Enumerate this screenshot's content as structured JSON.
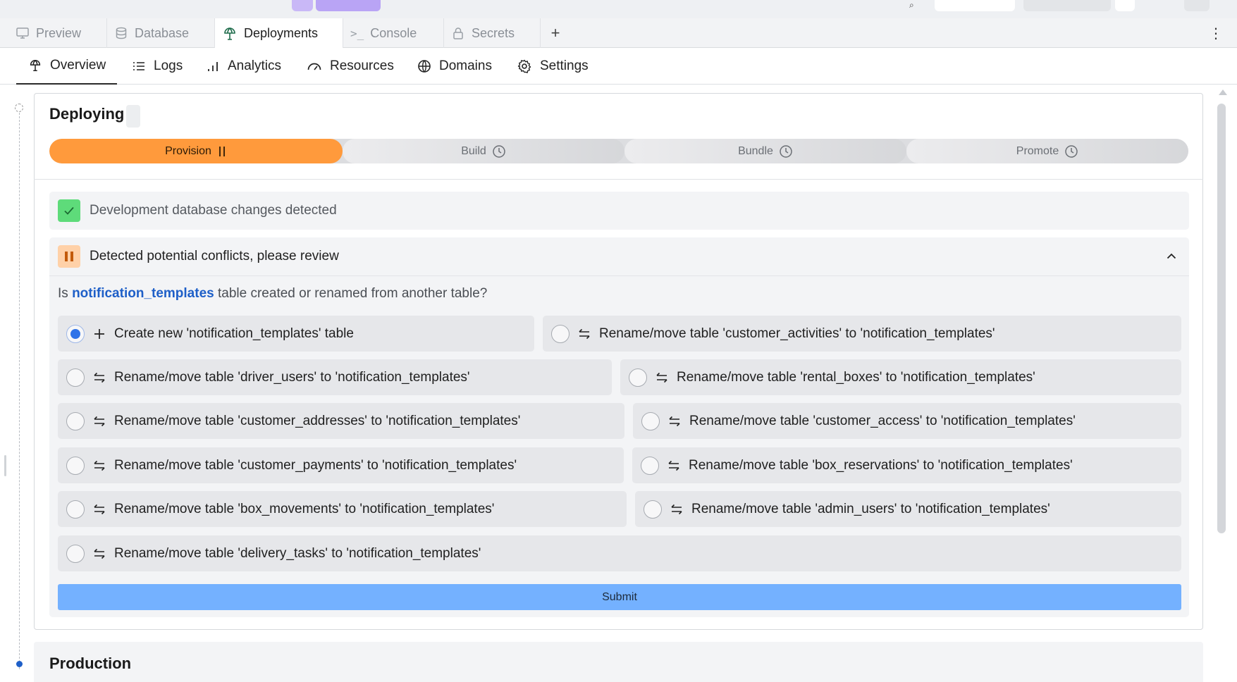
{
  "tabs": [
    {
      "label": "Preview",
      "icon": "monitor-icon",
      "active": false
    },
    {
      "label": "Database",
      "icon": "database-icon",
      "active": false
    },
    {
      "label": "Deployments",
      "icon": "deploy-icon",
      "active": true
    },
    {
      "label": "Console",
      "icon": "terminal-icon",
      "active": false
    },
    {
      "label": "Secrets",
      "icon": "lock-icon",
      "active": false
    }
  ],
  "add_tab": "+",
  "more": "⋮",
  "subnav": [
    {
      "label": "Overview",
      "icon": "deploy-icon",
      "active": true
    },
    {
      "label": "Logs",
      "icon": "list-icon"
    },
    {
      "label": "Analytics",
      "icon": "bar-chart-icon"
    },
    {
      "label": "Resources",
      "icon": "gauge-icon"
    },
    {
      "label": "Domains",
      "icon": "globe-icon"
    },
    {
      "label": "Settings",
      "icon": "gear-icon"
    }
  ],
  "deploy": {
    "title": "Deploying",
    "steps": [
      {
        "label": "Provision",
        "state": "paused",
        "status_icon": "pause-icon"
      },
      {
        "label": "Build",
        "state": "pending",
        "status_icon": "clock-icon"
      },
      {
        "label": "Bundle",
        "state": "pending",
        "status_icon": "clock-icon"
      },
      {
        "label": "Promote",
        "state": "pending",
        "status_icon": "clock-icon"
      }
    ],
    "db_changes": "Development database changes detected",
    "conflict_title": "Detected potential conflicts, please review",
    "question_prefix": "Is",
    "question_table": "notification_templates",
    "question_suffix": "table created or renamed from another table?",
    "options": [
      {
        "label": "Create new 'notification_templates' table",
        "icon": "plus-icon",
        "selected": true
      },
      {
        "label": "Rename/move table 'customer_activities' to 'notification_templates'",
        "icon": "swap-icon",
        "selected": false
      },
      {
        "label": "Rename/move table 'driver_users' to 'notification_templates'",
        "icon": "swap-icon",
        "selected": false
      },
      {
        "label": "Rename/move table 'rental_boxes' to 'notification_templates'",
        "icon": "swap-icon",
        "selected": false
      },
      {
        "label": "Rename/move table 'customer_addresses' to 'notification_templates'",
        "icon": "swap-icon",
        "selected": false
      },
      {
        "label": "Rename/move table 'customer_access' to 'notification_templates'",
        "icon": "swap-icon",
        "selected": false
      },
      {
        "label": "Rename/move table 'customer_payments' to 'notification_templates'",
        "icon": "swap-icon",
        "selected": false
      },
      {
        "label": "Rename/move table 'box_reservations' to 'notification_templates'",
        "icon": "swap-icon",
        "selected": false
      },
      {
        "label": "Rename/move table 'box_movements' to 'notification_templates'",
        "icon": "swap-icon",
        "selected": false
      },
      {
        "label": "Rename/move table 'admin_users' to 'notification_templates'",
        "icon": "swap-icon",
        "selected": false
      },
      {
        "label": "Rename/move table 'delivery_tasks' to 'notification_templates'",
        "icon": "swap-icon",
        "selected": false
      }
    ],
    "submit": "Submit"
  },
  "production": {
    "title": "Production"
  },
  "colors": {
    "accent": "#ff9a3c",
    "primary": "#74b1ff",
    "link": "#1e5fc8",
    "success": "#5edb7a"
  }
}
